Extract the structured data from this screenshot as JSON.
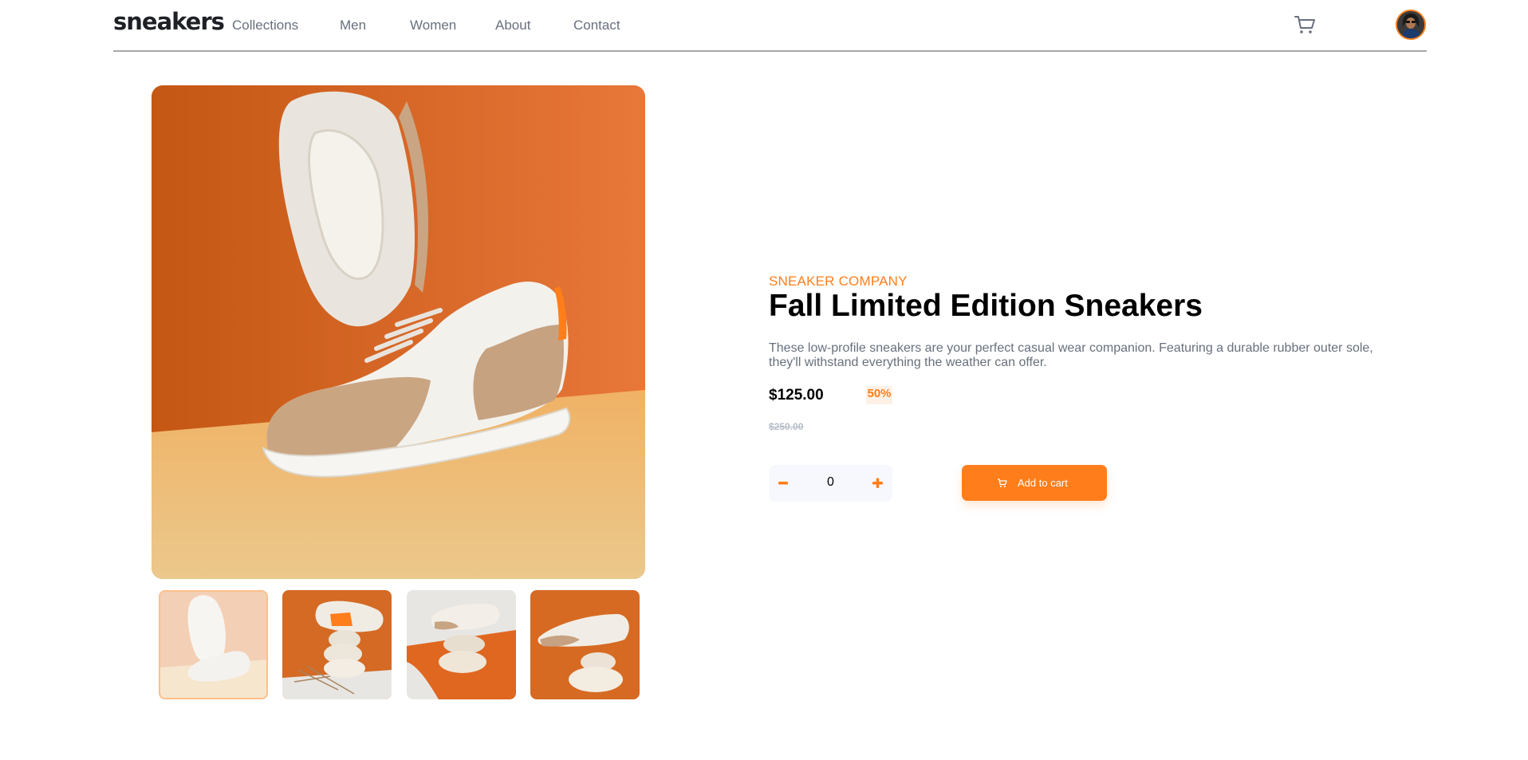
{
  "header": {
    "logo": "sneakers",
    "nav": [
      "Collections",
      "Men",
      "Women",
      "About",
      "Contact"
    ],
    "cart_icon": "cart-icon",
    "avatar_icon": "user-avatar"
  },
  "gallery": {
    "main_alt": "product-image-1",
    "thumbnails": [
      "thumbnail-1",
      "thumbnail-2",
      "thumbnail-3",
      "thumbnail-4"
    ],
    "active_thumbnail": 0
  },
  "product": {
    "company": "SNEAKER COMPANY",
    "title": "Fall Limited Edition Sneakers",
    "description": "These low-profile sneakers are your perfect casual wear companion. Featuring a durable rubber outer sole, they'll withstand everything the weather can offer.",
    "price": "$125.00",
    "discount": "50%",
    "old_price": "$250.00"
  },
  "cart_controls": {
    "quantity": "0",
    "minus_icon": "minus-icon",
    "plus_icon": "plus-icon",
    "add_label": "Add to cart",
    "add_icon": "cart-icon"
  },
  "colors": {
    "accent": "#ff7e1b",
    "pale_accent": "#fff1e6",
    "text_dark": "#1d2025",
    "text_gray": "#68707d",
    "light_gray": "#b6bcc8"
  }
}
